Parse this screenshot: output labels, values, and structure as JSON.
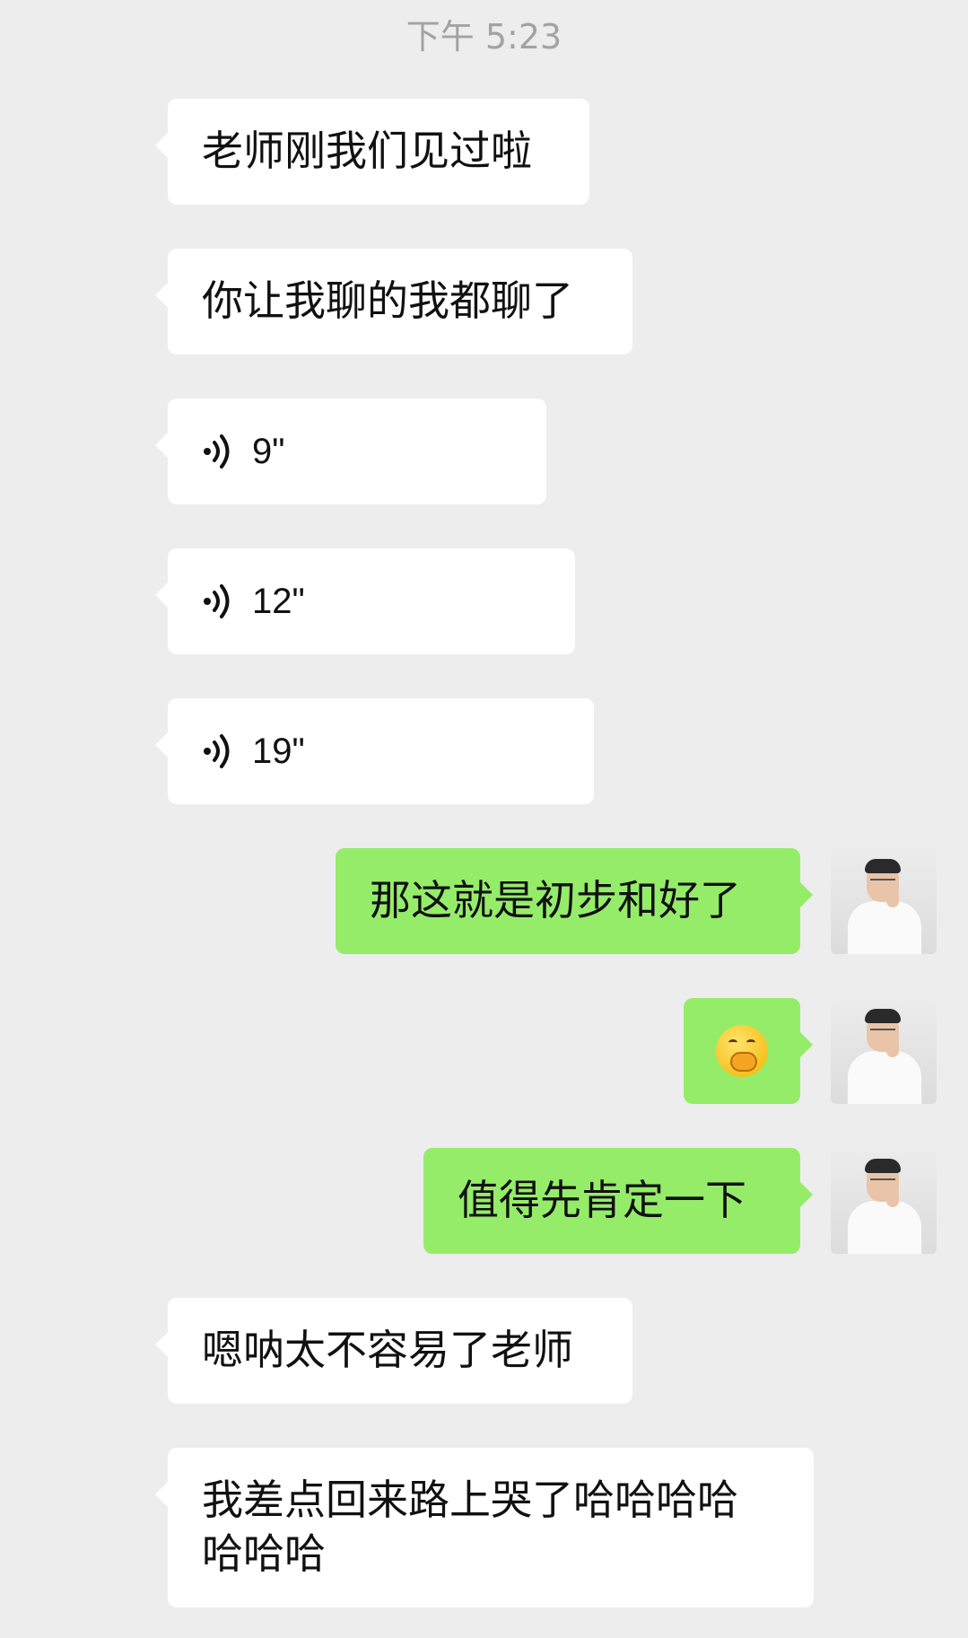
{
  "header": {
    "time": "下午 5:23"
  },
  "messages": [
    {
      "side": "left",
      "type": "text",
      "text": "老师刚我们见过啦"
    },
    {
      "side": "left",
      "type": "text",
      "text": "你让我聊的我都聊了"
    },
    {
      "side": "left",
      "type": "voice",
      "duration": "9\""
    },
    {
      "side": "left",
      "type": "voice",
      "duration": "12\""
    },
    {
      "side": "left",
      "type": "voice",
      "duration": "19\""
    },
    {
      "side": "right",
      "type": "text",
      "text": "那这就是初步和好了"
    },
    {
      "side": "right",
      "type": "emoji",
      "emoji": "thinking-hand-over-mouth-emoji"
    },
    {
      "side": "right",
      "type": "text",
      "text": "值得先肯定一下"
    },
    {
      "side": "left",
      "type": "text",
      "text": "嗯呐太不容易了老师"
    },
    {
      "side": "left",
      "type": "text",
      "text": "我差点回来路上哭了哈哈哈哈哈哈哈",
      "line1": "我差点回来路上哭了哈哈哈哈",
      "line2": "哈哈哈"
    }
  ],
  "colors": {
    "background": "#ededed",
    "self_bubble": "#95ec69",
    "other_bubble": "#ffffff",
    "time_text": "#a3a3a3"
  },
  "icons": {
    "voice": "voice-wave-icon",
    "avatar_left": "pixelated-avatar",
    "avatar_right": "profile-photo-avatar"
  }
}
